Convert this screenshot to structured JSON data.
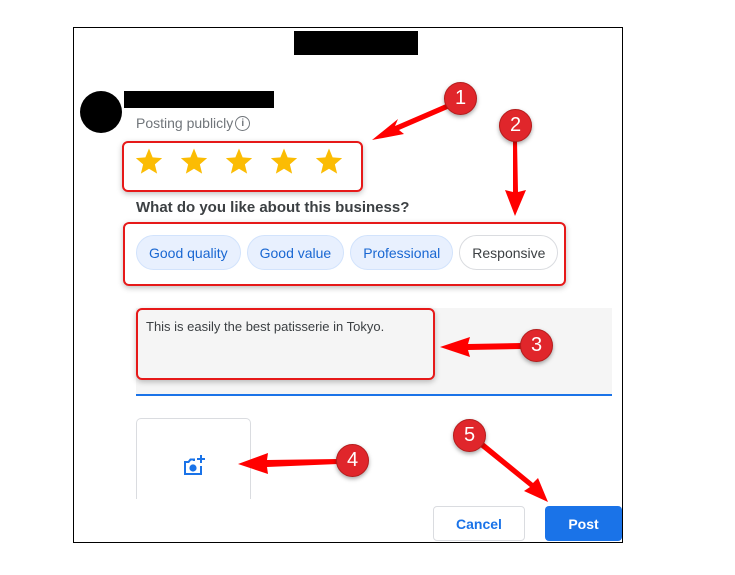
{
  "dialog": {
    "title_redacted": true,
    "user_name_redacted": true,
    "posting_label": "Posting publicly",
    "rating": {
      "value": 5,
      "max": 5,
      "star_color": "#fbbc04"
    },
    "question": "What do you like about this business?",
    "chips": [
      {
        "label": "Good quality",
        "selected": true
      },
      {
        "label": "Good value",
        "selected": true
      },
      {
        "label": "Professional",
        "selected": true
      },
      {
        "label": "Responsive",
        "selected": false
      }
    ],
    "review_text": "This is easily the best patisserie in Tokyo.",
    "add_photo_icon": "add-photo-camera-icon",
    "cancel_label": "Cancel",
    "post_label": "Post"
  },
  "annotations": {
    "color": "#e0262b",
    "badges": [
      "1",
      "2",
      "3",
      "4",
      "5"
    ]
  }
}
